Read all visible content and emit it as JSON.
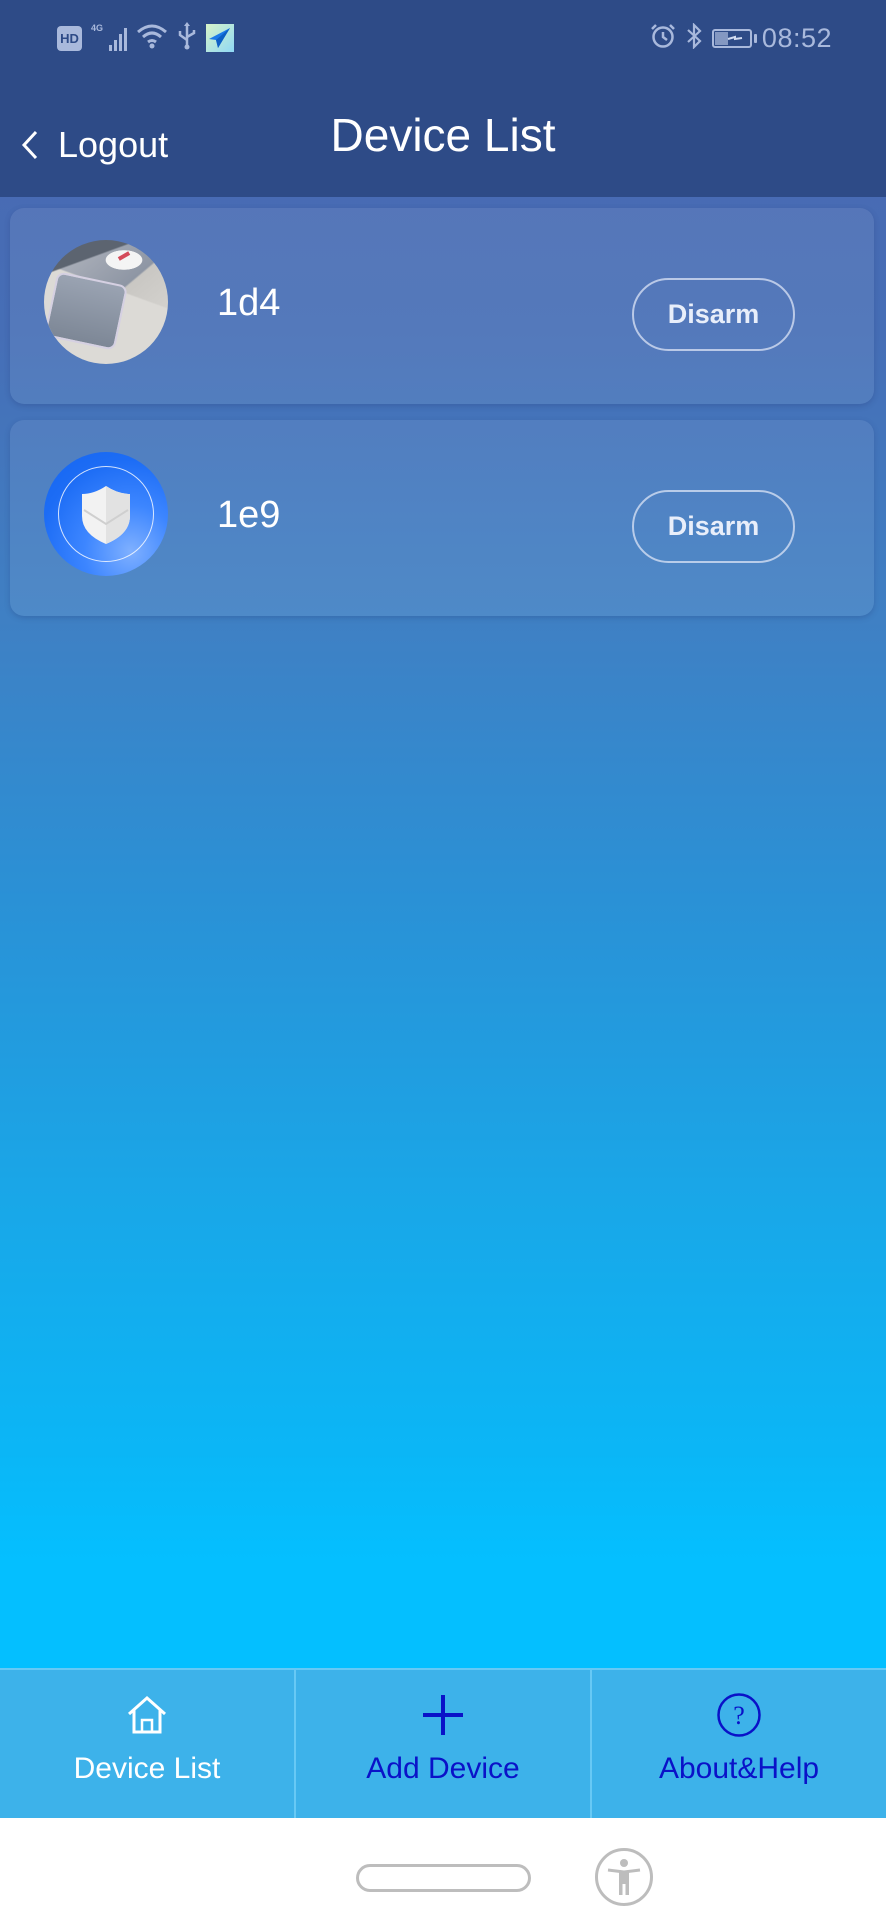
{
  "status_bar": {
    "left_icons": [
      "hd-icon",
      "4g-signal-icon",
      "wifi-icon",
      "usb-icon",
      "app-notification-icon"
    ],
    "hd_label": "HD",
    "network_label": "4G",
    "right_icons": [
      "alarm-icon",
      "bluetooth-icon",
      "battery-charging-icon"
    ],
    "time": "08:52"
  },
  "header": {
    "back_label": "Logout",
    "title": "Device List"
  },
  "devices": [
    {
      "name": "1d4",
      "avatar": "photo",
      "action_label": "Disarm"
    },
    {
      "name": "1e9",
      "avatar": "shield-icon",
      "action_label": "Disarm"
    }
  ],
  "tab_bar": {
    "tabs": [
      {
        "label": "Device List",
        "icon": "home-icon",
        "active": true
      },
      {
        "label": "Add Device",
        "icon": "plus-icon",
        "active": false
      },
      {
        "label": "About&Help",
        "icon": "help-icon",
        "active": false
      }
    ]
  },
  "colors": {
    "header_bg": "#2e4b87",
    "gradient_top": "#4a67b0",
    "gradient_bottom": "#04bfff",
    "tab_bar_bg": "#3db2ea",
    "inactive_tab_text": "#0a12c8",
    "active_tab_text": "#ffffff"
  }
}
